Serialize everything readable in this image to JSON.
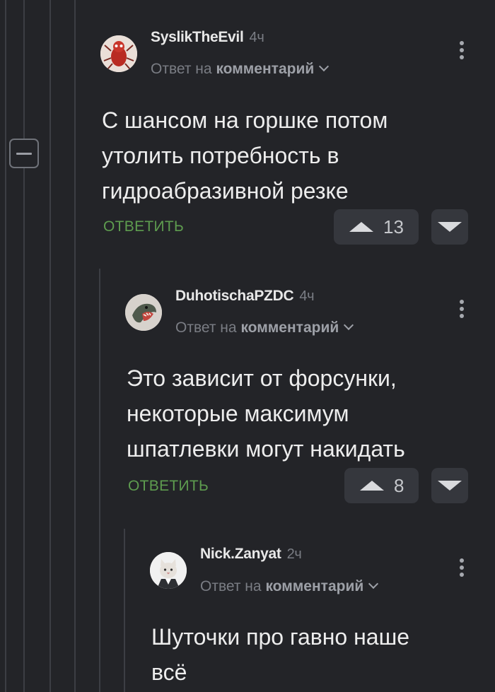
{
  "collapse": {
    "icon": "minus-icon"
  },
  "comments": [
    {
      "username": "SyslikTheEvil",
      "time": "4ч",
      "reply_prefix": "Ответ на",
      "reply_target": "комментарий",
      "lines": [
        "С шансом на горшке потом",
        "утолить потребность в",
        "гидроабразивной резке"
      ],
      "reply_label": "ОТВЕТИТЬ",
      "votes": "13",
      "avatar": "red-creature-avatar"
    },
    {
      "username": "DuhotischaPZDC",
      "time": "4ч",
      "reply_prefix": "Ответ на",
      "reply_target": "комментарий",
      "lines": [
        "Это зависит от форсунки,",
        "некоторые максимум",
        "шпатлевки могут накидать"
      ],
      "reply_label": "ОТВЕТИТЬ",
      "votes": "8",
      "avatar": "reptile-avatar"
    },
    {
      "username": "Nick.Zanyat",
      "time": "2ч",
      "reply_prefix": "Ответ на",
      "reply_target": "комментарий",
      "lines": [
        "Шуточки про гавно наше",
        "всё"
      ],
      "avatar": "cat-in-suit-avatar"
    }
  ]
}
